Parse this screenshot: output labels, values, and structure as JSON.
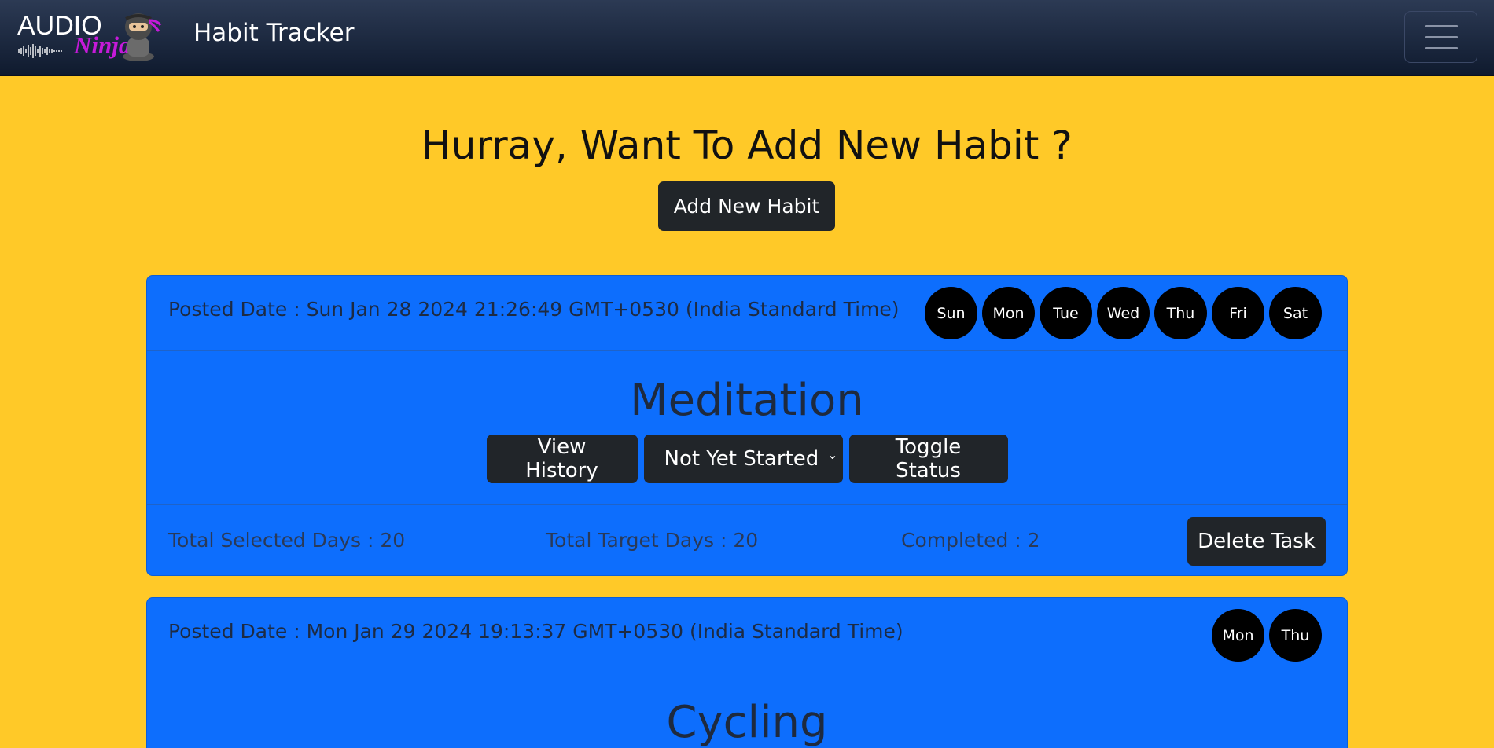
{
  "navbar": {
    "logo_text_audio": "AUDIO",
    "logo_text_ninja": "Ninja",
    "title": "Habit Tracker",
    "menu_icon": "hamburger-icon"
  },
  "hero": {
    "title": "Hurray, Want To Add New Habit ?",
    "add_button": "Add New Habit"
  },
  "habits": [
    {
      "posted": "Posted Date : Sun Jan 28 2024 21:26:49 GMT+0530 (India Standard Time)",
      "days": [
        "Sun",
        "Mon",
        "Tue",
        "Wed",
        "Thu",
        "Fri",
        "Sat"
      ],
      "name": "Meditation",
      "view_history": "View History",
      "status": "Not Yet Started",
      "toggle": "Toggle Status",
      "total_selected": "Total Selected Days : 20",
      "total_target": "Total Target Days : 20",
      "completed": "Completed : 2",
      "delete": "Delete Task"
    },
    {
      "posted": "Posted Date : Mon Jan 29 2024 19:13:37 GMT+0530 (India Standard Time)",
      "days": [
        "Mon",
        "Thu"
      ],
      "name": "Cycling"
    }
  ],
  "colors": {
    "background": "#ffc928",
    "card": "#0d6efd",
    "navbar": "#0f1a2e",
    "button": "#212529"
  }
}
